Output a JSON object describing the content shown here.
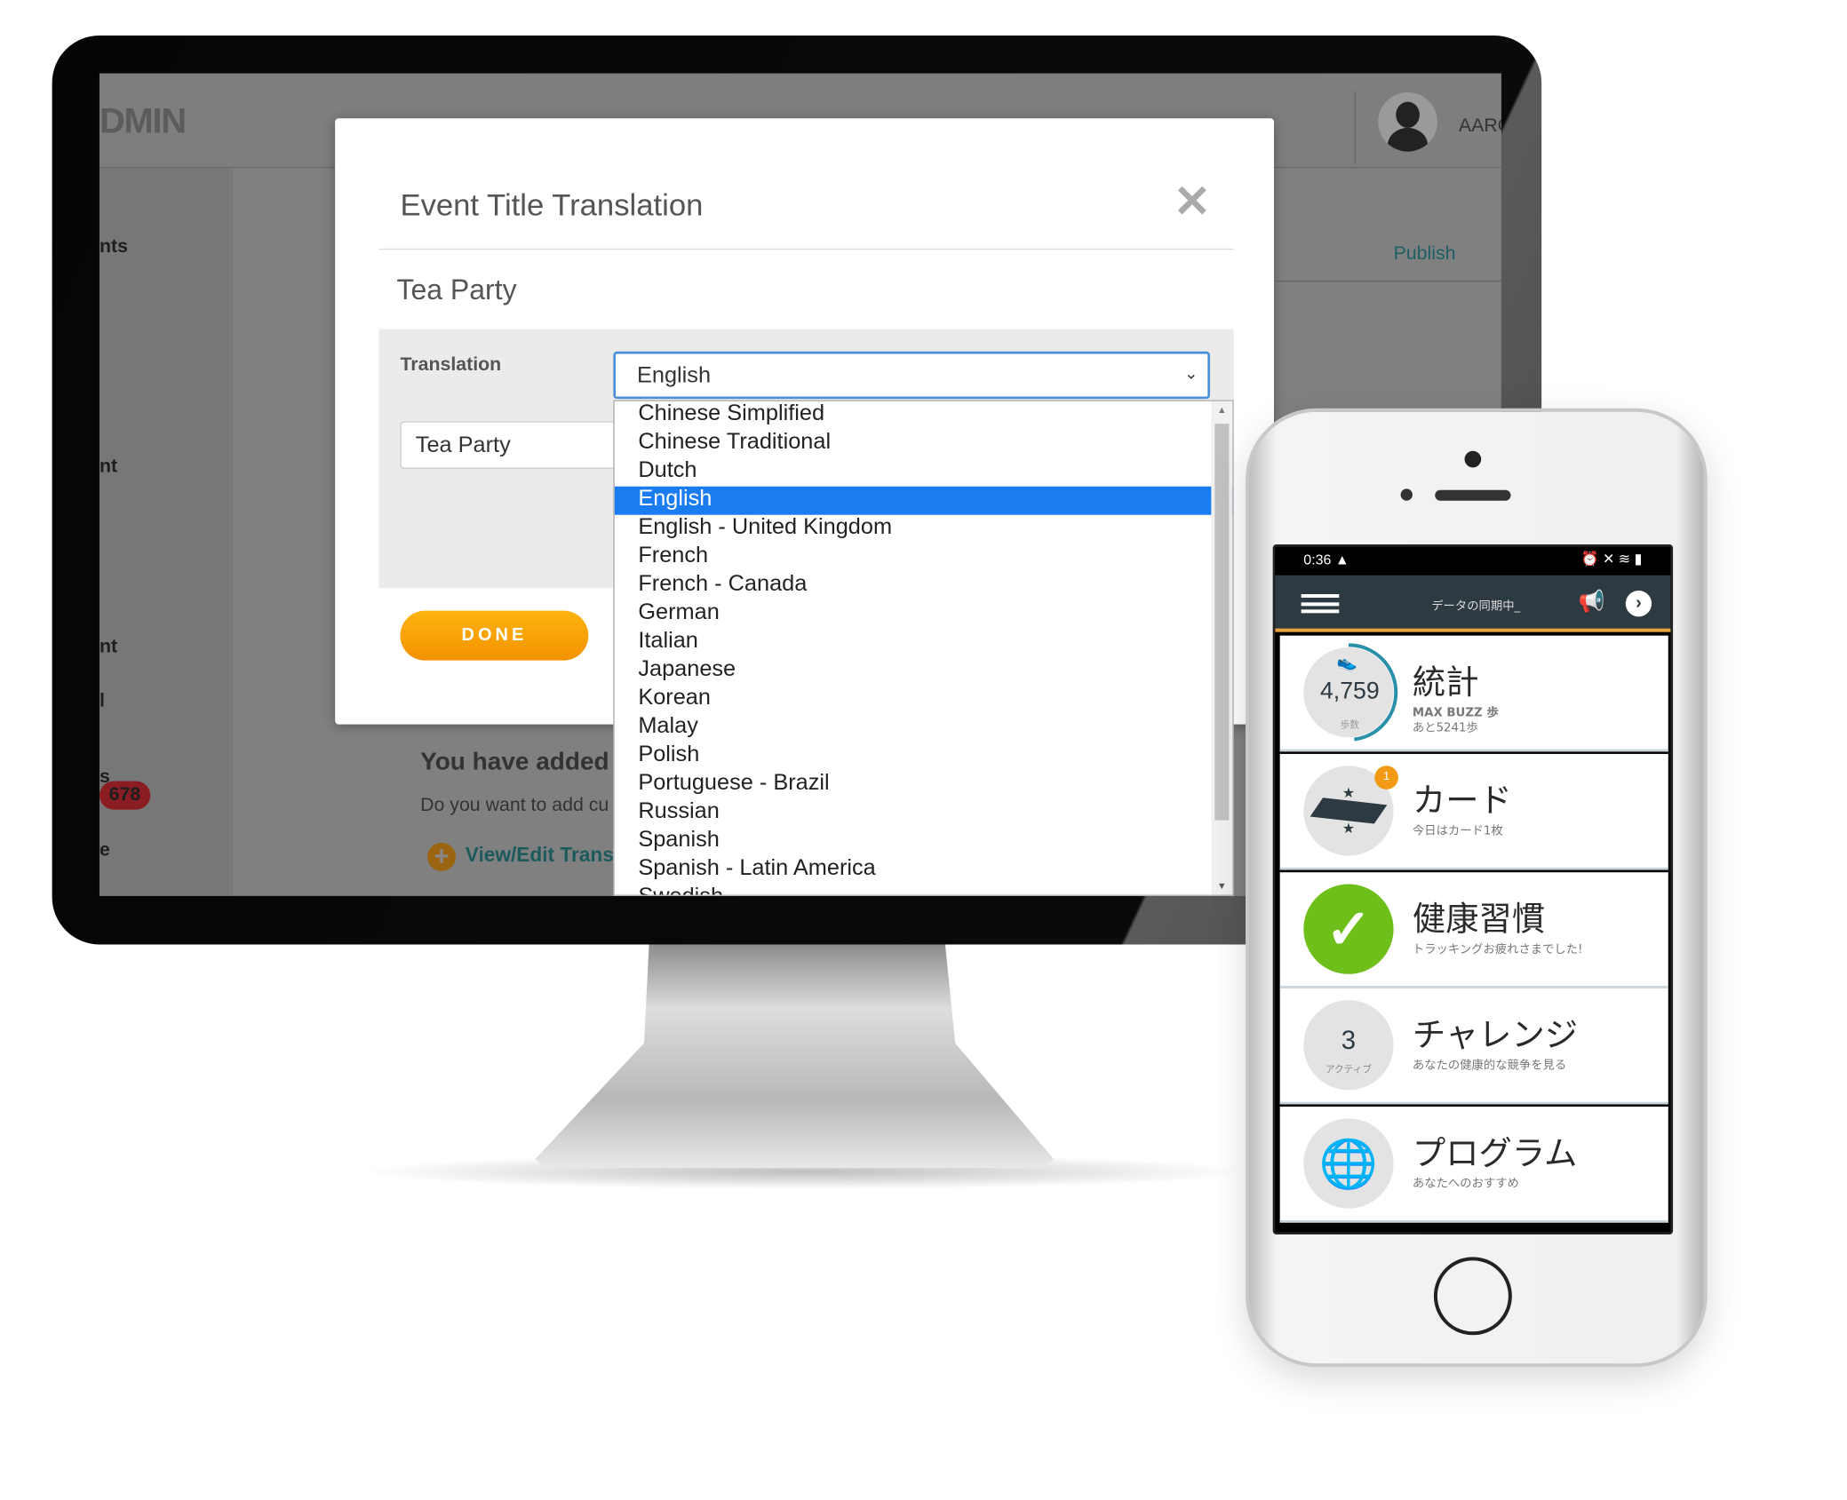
{
  "admin": {
    "logo_fragment": "DMIN",
    "user_fragment": "AARO",
    "publish_tab": "Publish",
    "sidebar": [
      "nts",
      "nt",
      "nt",
      "l",
      "s",
      "e"
    ],
    "badge_count": "678",
    "background_heading": "You have added",
    "background_text": "Do you want to add cu",
    "background_link": "View/Edit Trans"
  },
  "modal": {
    "title": "Event Title Translation",
    "close_icon": "close-icon",
    "event_name": "Tea Party",
    "translation_label": "Translation",
    "selected_language": "English",
    "translation_value": "Tea Party",
    "done_label": "DONE",
    "languages": [
      "Chinese Simplified",
      "Chinese Traditional",
      "Dutch",
      "English",
      "English - United Kingdom",
      "French",
      "French - Canada",
      "German",
      "Italian",
      "Japanese",
      "Korean",
      "Malay",
      "Polish",
      "Portuguese - Brazil",
      "Russian",
      "Spanish",
      "Spanish - Latin America",
      "Swedish"
    ]
  },
  "phone": {
    "time": "0:36",
    "header_title": "データの同期中_",
    "rows": [
      {
        "title": "統計",
        "sub1": "MAX BUZZ 歩",
        "sub2": "あと5241歩",
        "value": "4,759",
        "unit": "歩数",
        "progress": 0.48
      },
      {
        "title": "カード",
        "sub1": "今日はカード1枚",
        "badge": "1"
      },
      {
        "title": "健康習慣",
        "sub1": "トラッキングお疲れさまでした!"
      },
      {
        "title": "チャレンジ",
        "sub1": "あなたの健康的な競争を見る",
        "value": "3",
        "unit": "アクティブ"
      },
      {
        "title": "プログラム",
        "sub1": "あなたへのおすすめ"
      }
    ]
  },
  "colors": {
    "accent_orange": "#f5a000",
    "select_blue": "#1a7cf0",
    "app_header": "#2d3a42",
    "check_green": "#6fbf1a",
    "progress_teal": "#2a8fa8"
  }
}
